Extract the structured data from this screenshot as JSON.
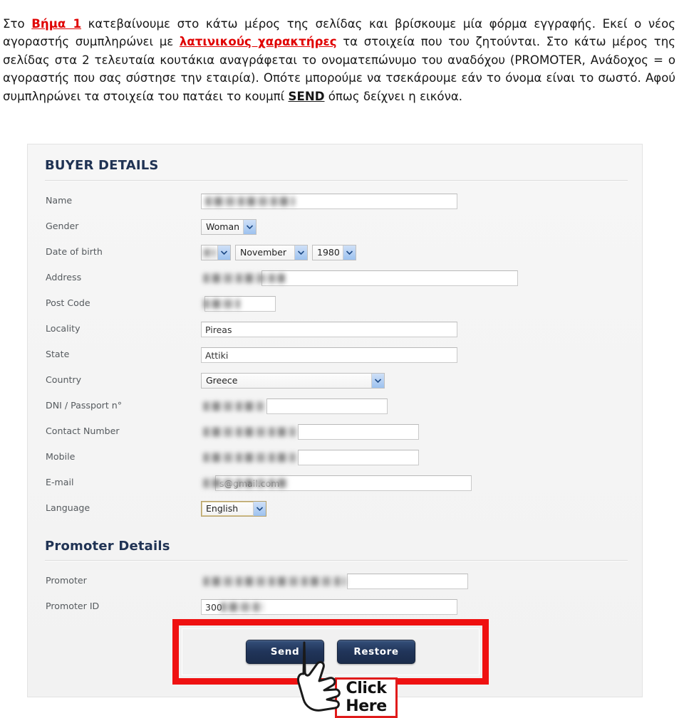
{
  "instructions": {
    "seg1": "Στο ",
    "step": "Βήμα 1",
    "seg2": " κατεβαίνουμε στο κάτω μέρος της σελίδας και βρίσκουμε μία φόρμα εγγραφής. Εκεί ο νέος αγοραστής συμπληρώνει με ",
    "latin": "λατινικούς χαρακτήρες",
    "seg3": " τα στοιχεία που του ζητούνται. Στο κάτω μέρος της σελίδας στα 2 τελευταία κουτάκια αναγράφεται το ονοματεπώνυμο του αναδόχου (PROMOTER, Ανάδοχος = ο αγοραστής που σας σύστησε την εταιρία). Οπότε μπορούμε να τσεκάρουμε εάν το όνομα είναι το σωστό. Αφού συμπληρώνει τα στοιχεία του πατάει το κουμπί ",
    "send": "SEND",
    "seg4": " όπως δείχνει η εικόνα."
  },
  "form": {
    "buyer_section_title": "BUYER DETAILS",
    "promoter_section_title": "Promoter Details",
    "fields": {
      "name_label": "Name",
      "name_value": "",
      "gender_label": "Gender",
      "gender_value": "Woman",
      "dob_label": "Date of birth",
      "dob_day_value": "",
      "dob_month_value": "November",
      "dob_year_value": "1980",
      "address_label": "Address",
      "address_value": "",
      "postcode_label": "Post Code",
      "postcode_value": "",
      "locality_label": "Locality",
      "locality_value": "Pireas",
      "state_label": "State",
      "state_value": "Attiki",
      "country_label": "Country",
      "country_value": "Greece",
      "dni_label": "DNI / Passport n°",
      "dni_value": "",
      "contact_label": "Contact Number",
      "contact_value": "",
      "mobile_label": "Mobile",
      "mobile_value": "",
      "email_label": "E-mail",
      "email_value": "s@gmail.com",
      "language_label": "Language",
      "language_value": "English",
      "promoter_label": "Promoter",
      "promoter_value": "",
      "promoter_id_label": "Promoter ID",
      "promoter_id_value": "300"
    },
    "buttons": {
      "send": "Send",
      "restore": "Restore"
    }
  },
  "overlay": {
    "click_line1": "Click",
    "click_line2": "Here"
  },
  "colors": {
    "highlight_red": "#e00000",
    "callout_red": "#ef1111",
    "button_navy": "#21355a",
    "section_title": "#203354"
  }
}
